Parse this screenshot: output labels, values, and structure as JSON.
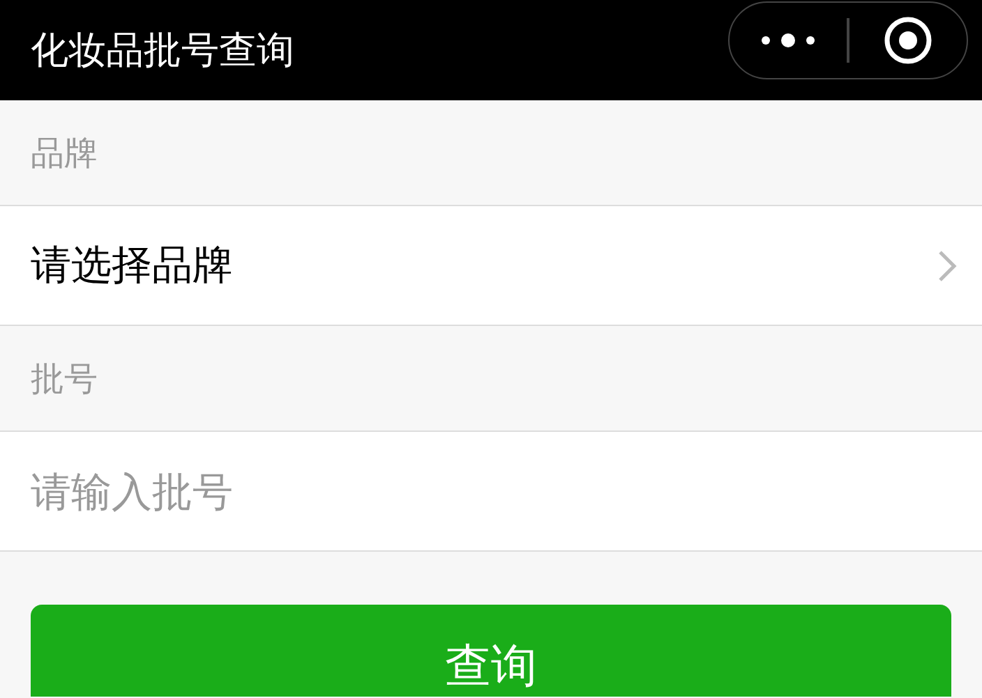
{
  "navbar": {
    "title": "化妆品批号查询"
  },
  "form": [
    {
      "kind": "select",
      "label": "品牌",
      "value": "请选择品牌"
    },
    {
      "kind": "input",
      "label": "批号",
      "placeholder": "请输入批号"
    }
  ],
  "submit_button": "查询"
}
